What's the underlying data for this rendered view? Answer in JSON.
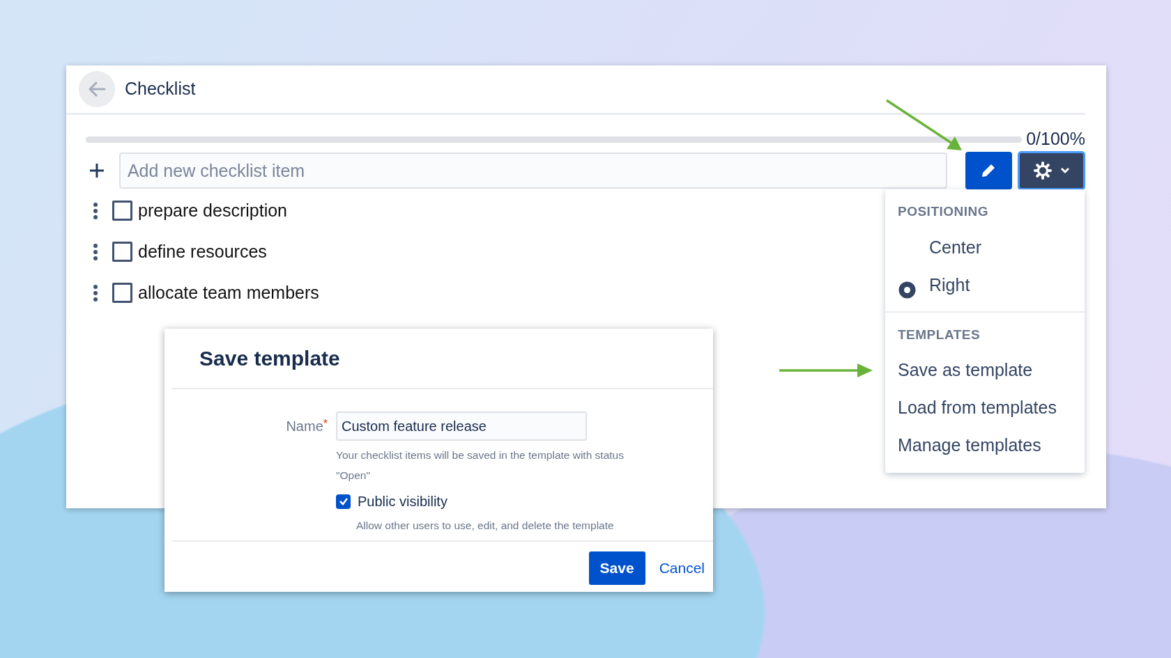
{
  "checklist": {
    "title": "Checklist",
    "progress": {
      "level": 0,
      "label": "0/100%"
    },
    "add_field": {
      "placeholder": "Add new checklist item"
    },
    "items": [
      {
        "text": "prepare description",
        "checked": false
      },
      {
        "text": "define resources",
        "checked": false
      },
      {
        "text": "allocate team members",
        "checked": false
      }
    ]
  },
  "settings_menu": {
    "sections": [
      {
        "heading": "POSITIONING",
        "kind": "radio",
        "options": [
          {
            "label": "Center",
            "selected": false
          },
          {
            "label": "Right",
            "selected": true
          }
        ]
      },
      {
        "heading": "TEMPLATES",
        "kind": "actions",
        "options": [
          {
            "label": "Save as template"
          },
          {
            "label": "Load from templates"
          },
          {
            "label": "Manage templates"
          }
        ]
      }
    ]
  },
  "dialog": {
    "title": "Save template",
    "name_field": {
      "label": "Name",
      "required_mark": "*",
      "value": "Custom feature release",
      "help": "Your checklist items will be saved in the template with status \"Open\""
    },
    "public_visibility": {
      "label": "Public visibility",
      "checked": true,
      "help": "Allow other users to use, edit, and delete the template"
    },
    "buttons": [
      {
        "label": "Save",
        "kind": "primary"
      },
      {
        "label": "Cancel",
        "kind": "link"
      }
    ]
  }
}
